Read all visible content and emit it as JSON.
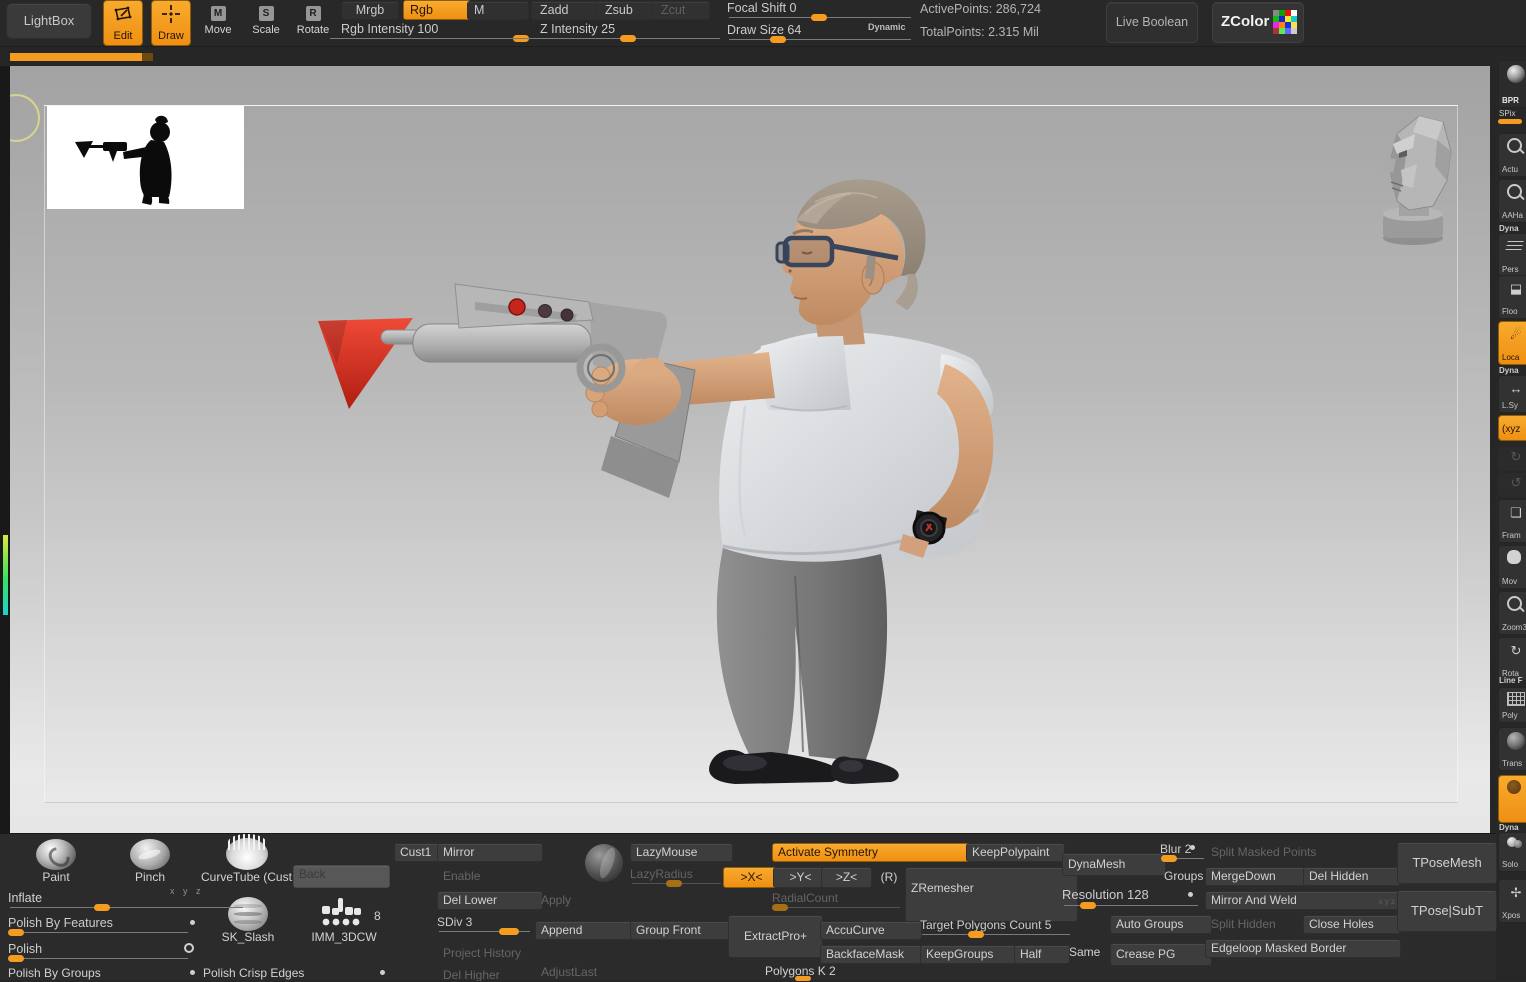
{
  "colors": {
    "accent_orange": "#f49c1f",
    "flag_red": "#d8281c",
    "skin": "#d4a27d",
    "shirt": "#dde0e3",
    "pants": "#7b7b7b",
    "canvas_top": "#a6a6a6",
    "canvas_bottom": "#ebebeb"
  },
  "topbar": {
    "lightbox": "LightBox",
    "edit": "Edit",
    "draw": "Draw",
    "move": "Move",
    "move_key": "M",
    "scale": "Scale",
    "scale_key": "S",
    "rotate": "Rotate",
    "rotate_key": "R",
    "mrgb": "Mrgb",
    "rgb": "Rgb",
    "m": "M",
    "rgb_intensity": "Rgb Intensity 100",
    "zadd": "Zadd",
    "zsub": "Zsub",
    "zcut": "Zcut",
    "z_intensity": "Z Intensity 25",
    "focal_shift": "Focal Shift 0",
    "draw_size": "Draw Size 64",
    "dynamic": "Dynamic",
    "active_points": "ActivePoints: 286,724",
    "total_points": "TotalPoints: 2.315 Mil",
    "live_boolean": "Live Boolean",
    "zcolor": "ZColor"
  },
  "sidebar": {
    "bpr": "BPR",
    "spix": "SPix",
    "actual": "Actu",
    "aahalf": "AAHa",
    "dyna_a": "Dyna",
    "persp": "Pers",
    "floor": "Floo",
    "local": "Loca",
    "dyna_b": "Dyna",
    "lsym": "L.Sy",
    "xyz": "(xyz",
    "frame": "Fram",
    "move": "Mov",
    "zoom3d": "Zoom3",
    "rotate": "Rota",
    "line_f": "Line F",
    "polyf": "Poly",
    "transp": "Trans",
    "dyna_c": "Dyna",
    "solo": "Solo",
    "xpose": "Xpos"
  },
  "brushes": {
    "paint": "Paint",
    "pinch": "Pinch",
    "curvetube": "CurveTube (Cust",
    "back": "Back",
    "sk_slash": "SK_Slash",
    "imm": "IMM_3DCW",
    "imm_count": "8",
    "xyz_hint": "x y z"
  },
  "left_panel": {
    "inflate": "Inflate",
    "polish_by_features": "Polish By Features",
    "polish": "Polish",
    "polish_by_groups": "Polish By Groups",
    "polish_crisp_edges": "Polish Crisp Edges"
  },
  "geometry": {
    "cust1": "Cust1",
    "mirror": "Mirror",
    "enable": "Enable",
    "del_lower": "Del Lower",
    "sdiv": "SDiv 3",
    "project_history": "Project History",
    "del_higher": "Del Higher",
    "apply": "Apply",
    "append": "Append",
    "adjust_last": "AdjustLast",
    "group_front": "Group Front"
  },
  "stroke": {
    "lazymouse": "LazyMouse",
    "lazyradius": "LazyRadius"
  },
  "symmetry": {
    "activate": "Activate Symmetry",
    "x": ">X<",
    "y": ">Y<",
    "z": ">Z<",
    "r": "(R)",
    "radial_count": "RadialCount"
  },
  "remesh": {
    "keep_polypaint": "KeepPolypaint",
    "zremesher": "ZRemesher",
    "extract_pro": "ExtractPro+",
    "accu_curve": "AccuCurve",
    "backface_mask": "BackfaceMask",
    "target_polygons": "Target Polygons Count 5",
    "keep_groups": "KeepGroups",
    "half": "Half",
    "same": "Same",
    "polygons": "Polygons K 2"
  },
  "dynamesh": {
    "label": "DynaMesh",
    "blur": "Blur 2",
    "groups": "Groups",
    "resolution": "Resolution 128",
    "auto_groups": "Auto Groups",
    "crease_pg": "Crease PG"
  },
  "modify_topology": {
    "split_masked_points": "Split Masked Points",
    "merge_down": "MergeDown",
    "del_hidden": "Del Hidden",
    "mirror_and_weld": "Mirror And Weld",
    "mw_axes": "x y z",
    "split_hidden": "Split Hidden",
    "close_holes": "Close Holes",
    "edgeloop_masked_border": "Edgeloop Masked Border",
    "tpose_mesh": "TPoseMesh",
    "tpose_subt": "TPose|SubT"
  }
}
